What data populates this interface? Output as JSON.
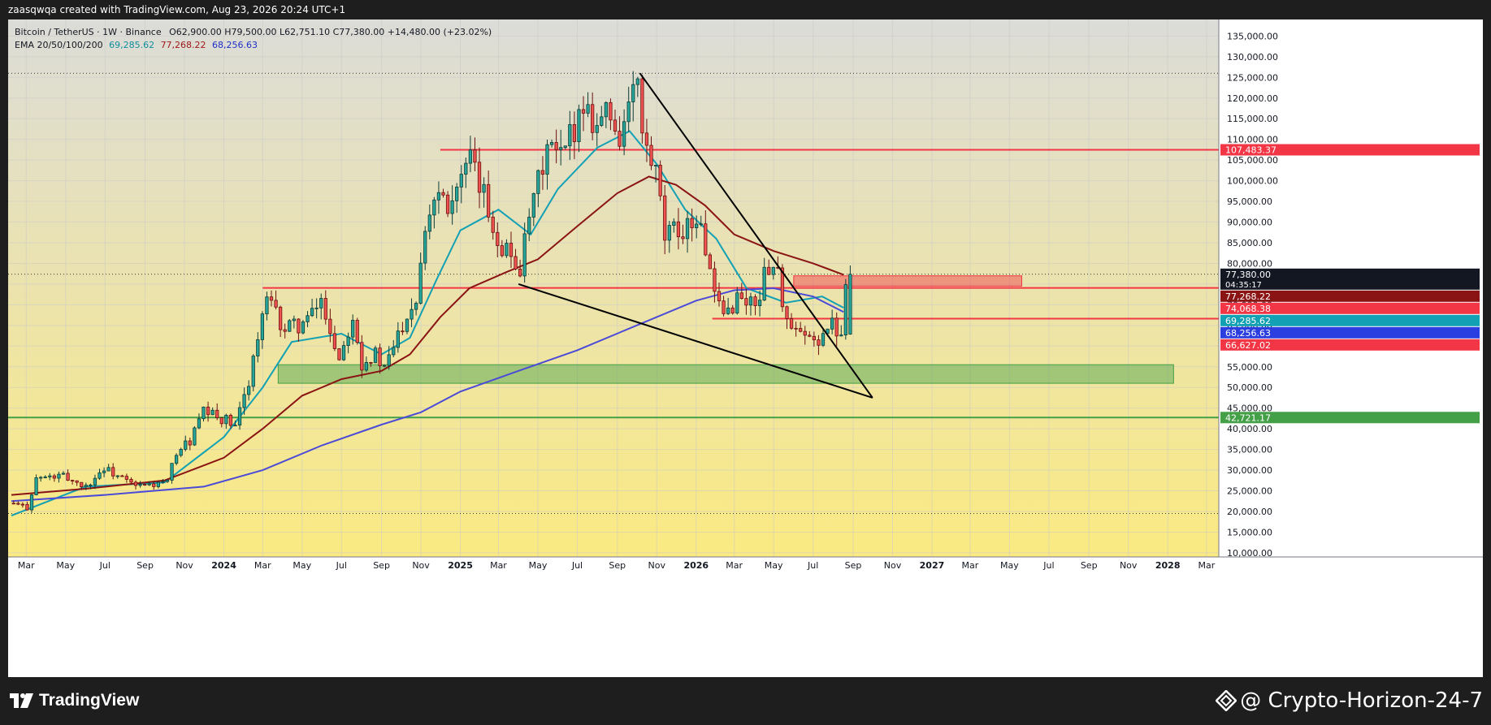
{
  "header": {
    "text": "zaasqwqa created with TradingView.com, Aug 23, 2026 20:24 UTC+1"
  },
  "legend": {
    "symbol": "Bitcoin / TetherUS · 1W · Binance",
    "ohlc": "O62,900.00  H79,500.00  L62,751.10  C77,380.00  +14,480.00 (+23.02%)",
    "ema_label": "EMA 20/50/100/200",
    "ema_values": [
      "69,285.62",
      "77,268.22",
      "68,256.63"
    ]
  },
  "footer": {
    "brand": "TradingView",
    "watermark": "@ Crypto-Horizon-24-7"
  },
  "colors": {
    "bull": "#26a69a",
    "bear": "#ef5350",
    "ema20": "#12a1b4",
    "ema50": "#8a1414",
    "ema200": "#4b4bd8",
    "resistance": "#f23645",
    "support": "#43a047",
    "bg_top": "#dcdcd8",
    "bg_bottom": "#fbea82"
  },
  "chart_data": {
    "type": "candlestick",
    "symbol": "BTCUSDT",
    "interval": "1W",
    "ylim": [
      9000,
      139000
    ],
    "y_ticks": [
      "135,000.00",
      "130,000.00",
      "125,000.00",
      "120,000.00",
      "115,000.00",
      "110,000.00",
      "105,000.00",
      "100,000.00",
      "95,000.00",
      "90,000.00",
      "85,000.00",
      "80,000.00",
      "75,000.00",
      "70,000.00",
      "65,000.00",
      "60,000.00",
      "55,000.00",
      "50,000.00",
      "45,000.00",
      "40,000.00",
      "35,000.00",
      "30,000.00",
      "25,000.00",
      "20,000.00",
      "15,000.00",
      "10,000.00"
    ],
    "y_tick_values": [
      135000,
      130000,
      125000,
      120000,
      115000,
      110000,
      105000,
      100000,
      95000,
      90000,
      85000,
      80000,
      75000,
      70000,
      65000,
      60000,
      55000,
      50000,
      45000,
      40000,
      35000,
      30000,
      25000,
      20000,
      15000,
      10000
    ],
    "x_ticks": [
      {
        "label": "Mar",
        "date": "2023-03-01",
        "bold": false
      },
      {
        "label": "May",
        "date": "2023-05-01",
        "bold": false
      },
      {
        "label": "Jul",
        "date": "2023-07-01",
        "bold": false
      },
      {
        "label": "Sep",
        "date": "2023-09-01",
        "bold": false
      },
      {
        "label": "Nov",
        "date": "2023-11-01",
        "bold": false
      },
      {
        "label": "2024",
        "date": "2024-01-01",
        "bold": true
      },
      {
        "label": "Mar",
        "date": "2024-03-01",
        "bold": false
      },
      {
        "label": "May",
        "date": "2024-05-01",
        "bold": false
      },
      {
        "label": "Jul",
        "date": "2024-07-01",
        "bold": false
      },
      {
        "label": "Sep",
        "date": "2024-09-01",
        "bold": false
      },
      {
        "label": "Nov",
        "date": "2024-11-01",
        "bold": false
      },
      {
        "label": "2025",
        "date": "2025-01-01",
        "bold": true
      },
      {
        "label": "Mar",
        "date": "2025-03-01",
        "bold": false
      },
      {
        "label": "May",
        "date": "2025-05-01",
        "bold": false
      },
      {
        "label": "Jul",
        "date": "2025-07-01",
        "bold": false
      },
      {
        "label": "Sep",
        "date": "2025-09-01",
        "bold": false
      },
      {
        "label": "Nov",
        "date": "2025-11-01",
        "bold": false
      },
      {
        "label": "2026",
        "date": "2026-01-01",
        "bold": true
      },
      {
        "label": "Mar",
        "date": "2026-03-01",
        "bold": false
      },
      {
        "label": "May",
        "date": "2026-05-01",
        "bold": false
      },
      {
        "label": "Jul",
        "date": "2026-07-01",
        "bold": false
      },
      {
        "label": "Sep",
        "date": "2026-09-01",
        "bold": false
      },
      {
        "label": "Nov",
        "date": "2026-11-01",
        "bold": false
      },
      {
        "label": "2027",
        "date": "2027-01-01",
        "bold": true
      },
      {
        "label": "Mar",
        "date": "2027-03-01",
        "bold": false
      },
      {
        "label": "May",
        "date": "2027-05-01",
        "bold": false
      },
      {
        "label": "Jul",
        "date": "2027-07-01",
        "bold": false
      },
      {
        "label": "Sep",
        "date": "2027-09-01",
        "bold": false
      },
      {
        "label": "Nov",
        "date": "2027-11-01",
        "bold": false
      },
      {
        "label": "2028",
        "date": "2028-01-01",
        "bold": true
      },
      {
        "label": "Mar",
        "date": "2028-03-01",
        "bold": false
      }
    ],
    "close_path": [
      [
        "2023-02-06",
        22000
      ],
      [
        "2023-03-06",
        21000
      ],
      [
        "2023-03-20",
        28000
      ],
      [
        "2023-05-01",
        28500
      ],
      [
        "2023-06-05",
        26000
      ],
      [
        "2023-07-03",
        30500
      ],
      [
        "2023-08-21",
        26000
      ],
      [
        "2023-09-18",
        26500
      ],
      [
        "2023-10-09",
        27000
      ],
      [
        "2023-10-23",
        34500
      ],
      [
        "2023-11-13",
        37000
      ],
      [
        "2023-12-04",
        44000
      ],
      [
        "2024-01-08",
        42000
      ],
      [
        "2024-01-22",
        40000
      ],
      [
        "2024-02-12",
        52000
      ],
      [
        "2024-02-26",
        62000
      ],
      [
        "2024-03-11",
        71000
      ],
      [
        "2024-04-08",
        64000
      ],
      [
        "2024-05-13",
        66000
      ],
      [
        "2024-06-03",
        71000
      ],
      [
        "2024-07-01",
        57000
      ],
      [
        "2024-07-22",
        68000
      ],
      [
        "2024-08-05",
        56000
      ],
      [
        "2024-08-26",
        58000
      ],
      [
        "2024-09-09",
        54000
      ],
      [
        "2024-09-30",
        63000
      ],
      [
        "2024-10-14",
        68000
      ],
      [
        "2024-10-28",
        72000
      ],
      [
        "2024-11-11",
        90000
      ],
      [
        "2024-12-02",
        99000
      ],
      [
        "2024-12-16",
        95000
      ],
      [
        "2025-01-20",
        104000
      ],
      [
        "2025-02-10",
        96000
      ],
      [
        "2025-03-03",
        86000
      ],
      [
        "2025-04-07",
        79000
      ],
      [
        "2025-04-28",
        95000
      ],
      [
        "2025-05-19",
        108000
      ],
      [
        "2025-06-09",
        105000
      ],
      [
        "2025-07-14",
        119000
      ],
      [
        "2025-08-04",
        114000
      ],
      [
        "2025-08-18",
        117000
      ],
      [
        "2025-09-08",
        111000
      ],
      [
        "2025-10-06",
        124000
      ],
      [
        "2025-10-13",
        110000
      ],
      [
        "2025-11-03",
        101000
      ],
      [
        "2025-11-17",
        86000
      ],
      [
        "2025-12-08",
        88000
      ],
      [
        "2026-01-05",
        91000
      ],
      [
        "2026-01-19",
        84000
      ],
      [
        "2026-02-02",
        71000
      ],
      [
        "2026-02-16",
        67000
      ],
      [
        "2026-03-09",
        72000
      ],
      [
        "2026-04-06",
        70000
      ],
      [
        "2026-04-27",
        80000
      ],
      [
        "2026-05-11",
        78000
      ],
      [
        "2026-05-25",
        65000
      ],
      [
        "2026-06-15",
        62000
      ],
      [
        "2026-07-06",
        61000
      ],
      [
        "2026-08-03",
        65000
      ],
      [
        "2026-08-17",
        62900
      ],
      [
        "2026-08-24",
        77380
      ]
    ],
    "last_candle": {
      "date": "2026-08-24",
      "open": 62900.0,
      "high": 79500.0,
      "low": 62751.1,
      "close": 77380.0,
      "change": 14480.0,
      "change_pct": 23.02
    },
    "ema_path": {
      "ema20": [
        [
          "2023-02-06",
          19000
        ],
        [
          "2023-06-01",
          26000
        ],
        [
          "2023-10-01",
          27000
        ],
        [
          "2024-01-01",
          38000
        ],
        [
          "2024-03-01",
          50000
        ],
        [
          "2024-04-15",
          61000
        ],
        [
          "2024-07-01",
          63000
        ],
        [
          "2024-09-01",
          58000
        ],
        [
          "2024-10-15",
          62000
        ],
        [
          "2024-11-25",
          76000
        ],
        [
          "2025-01-01",
          88000
        ],
        [
          "2025-03-01",
          93000
        ],
        [
          "2025-04-20",
          87000
        ],
        [
          "2025-06-01",
          98000
        ],
        [
          "2025-08-01",
          108000
        ],
        [
          "2025-09-20",
          112000
        ],
        [
          "2025-11-01",
          104000
        ],
        [
          "2025-12-15",
          93000
        ],
        [
          "2026-02-01",
          86000
        ],
        [
          "2026-03-20",
          74000
        ],
        [
          "2026-05-20",
          70500
        ],
        [
          "2026-07-15",
          72000
        ],
        [
          "2026-08-17",
          69285.62
        ]
      ],
      "ema50": [
        [
          "2023-02-06",
          24000
        ],
        [
          "2023-06-01",
          25500
        ],
        [
          "2023-10-01",
          27500
        ],
        [
          "2024-01-01",
          33000
        ],
        [
          "2024-03-01",
          40000
        ],
        [
          "2024-05-01",
          48000
        ],
        [
          "2024-07-01",
          52000
        ],
        [
          "2024-09-01",
          54000
        ],
        [
          "2024-10-15",
          58000
        ],
        [
          "2024-12-01",
          67000
        ],
        [
          "2025-01-15",
          74000
        ],
        [
          "2025-03-15",
          78000
        ],
        [
          "2025-05-01",
          81000
        ],
        [
          "2025-07-01",
          89000
        ],
        [
          "2025-09-01",
          97000
        ],
        [
          "2025-10-20",
          101000
        ],
        [
          "2025-12-01",
          99000
        ],
        [
          "2026-01-15",
          94000
        ],
        [
          "2026-03-01",
          87000
        ],
        [
          "2026-05-01",
          83000
        ],
        [
          "2026-07-01",
          80000
        ],
        [
          "2026-08-17",
          77268.22
        ]
      ],
      "ema200": [
        [
          "2023-02-06",
          22500
        ],
        [
          "2023-07-01",
          24000
        ],
        [
          "2023-12-01",
          26000
        ],
        [
          "2024-03-01",
          30000
        ],
        [
          "2024-06-01",
          36000
        ],
        [
          "2024-09-01",
          41000
        ],
        [
          "2024-11-01",
          44000
        ],
        [
          "2025-01-01",
          49000
        ],
        [
          "2025-04-01",
          54000
        ],
        [
          "2025-07-01",
          59000
        ],
        [
          "2025-10-01",
          65000
        ],
        [
          "2026-01-01",
          71000
        ],
        [
          "2026-03-01",
          73500
        ],
        [
          "2026-05-01",
          74000
        ],
        [
          "2026-07-01",
          72000
        ],
        [
          "2026-08-17",
          68256.63
        ]
      ]
    },
    "horizontal_levels": [
      {
        "price": 107483.37,
        "label": "107,483.37",
        "color": "#f23645",
        "from": "2024-12-01"
      },
      {
        "price": 74068.38,
        "label": "74,068.38",
        "color": "#f23645",
        "from": "2024-03-01"
      },
      {
        "price": 66627.02,
        "label": "66,627.02",
        "color": "#f23645",
        "from": "2026-01-26"
      },
      {
        "price": 42721.17,
        "label": "42,721.17",
        "color": "#43a047",
        "from": "2023-02-01"
      }
    ],
    "zones": [
      {
        "from": "2026-06-01",
        "to": "2027-05-20",
        "low": 74500,
        "high": 77000,
        "color": "#f23645"
      },
      {
        "from": "2024-03-25",
        "to": "2028-01-10",
        "low": 51000,
        "high": 55500,
        "color": "#43a047"
      }
    ],
    "trend_lines": [
      {
        "x1": "2025-10-06",
        "y1": 126000,
        "x2": "2026-10-01",
        "y2": 47500
      },
      {
        "x1": "2025-04-01",
        "y1": 75000,
        "x2": "2026-10-01",
        "y2": 47500
      }
    ],
    "price_tags": [
      {
        "label": "77,380.00",
        "sub": "04:35:17",
        "price": 77380,
        "color": "#131722"
      },
      {
        "label": "77,268.22",
        "price": 77268.22,
        "color": "#8a1414"
      },
      {
        "label": "74,068.38",
        "price": 74068.38,
        "color": "#f23645"
      },
      {
        "label": "69,285.62",
        "price": 69285.62,
        "color": "#12a1b4"
      },
      {
        "label": "68,256.63",
        "price": 68256.63,
        "color": "#2b3ee0"
      },
      {
        "label": "66,627.02",
        "price": 66627.02,
        "color": "#f23645"
      },
      {
        "label": "107,483.37",
        "price": 107483.37,
        "color": "#f23645"
      },
      {
        "label": "42,721.17",
        "price": 42721.17,
        "color": "#43a047"
      }
    ],
    "dotted_levels": [
      126000,
      19500,
      77380
    ],
    "x_range": [
      "2023-02-01",
      "2028-03-20"
    ]
  }
}
